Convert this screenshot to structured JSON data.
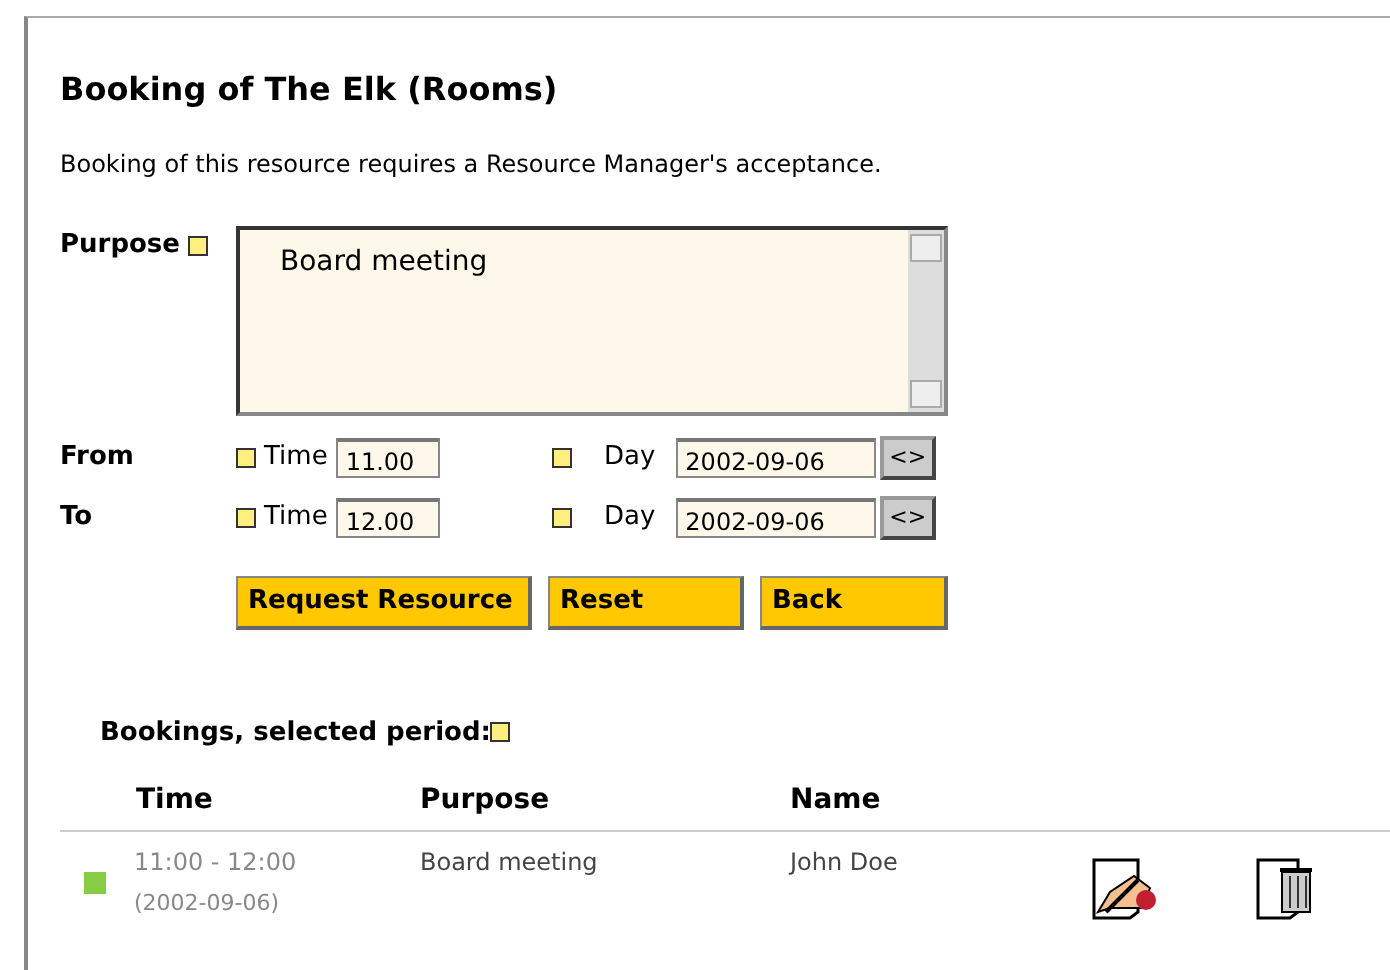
{
  "title": "Booking of The Elk (Rooms)",
  "notice": "Booking of this resource requires a Resource Manager's acceptance.",
  "purpose": {
    "label": "Purpose",
    "value": "Board meeting"
  },
  "period": [
    {
      "label": "From",
      "time_label": "Time",
      "time": "11.00",
      "day_label": "Day",
      "day": "2002-09-06",
      "picker": "<>"
    },
    {
      "label": "To",
      "time_label": "Time",
      "time": "12.00",
      "day_label": "Day",
      "day": "2002-09-06",
      "picker": "<>"
    }
  ],
  "buttons": [
    "Request Resource",
    "Reset",
    "Back"
  ],
  "bookings": {
    "title": "Bookings, selected period:",
    "columns": [
      "Time",
      "Purpose",
      "Name"
    ],
    "rows": [
      {
        "color": "#88cc44",
        "time": "11:00 - 12:00",
        "date": "(2002-09-06)",
        "purpose": "Board meeting",
        "name": "John Doe"
      }
    ]
  }
}
